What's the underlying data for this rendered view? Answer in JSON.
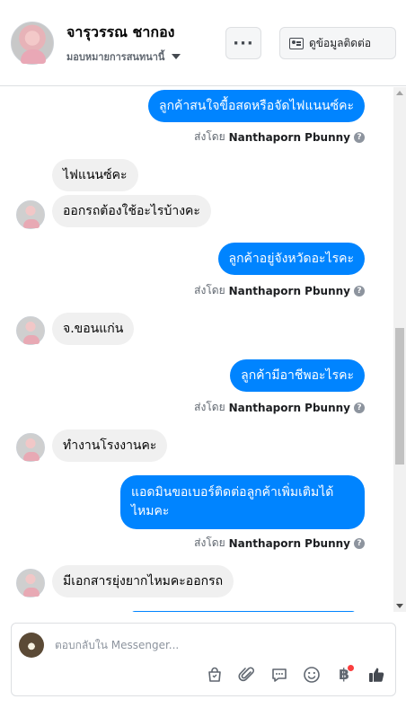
{
  "header": {
    "name": "จารุวรรณ ชากอง",
    "assign_label": "มอบหมายการสนทนานี้",
    "more_label": "···",
    "contact_button_label": "ดูข้อมูลติดต่อ"
  },
  "messages": [
    {
      "direction": "out",
      "text": "ลูกค้าสนใจขื้อสดหรือจัดไฟแนนซ์คะ"
    },
    {
      "direction": "meta",
      "sent_by_prefix": "ส่งโดย",
      "sender": "Nanthaporn Pbunny"
    },
    {
      "direction": "in",
      "text": "ไฟแนนซ์คะ"
    },
    {
      "direction": "in",
      "text": "ออกรถต้องใช้อะไรบ้างคะ"
    },
    {
      "direction": "out",
      "text": "ลูกค้าอยู่จังหวัดอะไรคะ"
    },
    {
      "direction": "meta",
      "sent_by_prefix": "ส่งโดย",
      "sender": "Nanthaporn Pbunny"
    },
    {
      "direction": "in",
      "text": "จ.ขอนแก่น"
    },
    {
      "direction": "out",
      "text": "ลูกค้ามีอาชีพอะไรคะ"
    },
    {
      "direction": "meta",
      "sent_by_prefix": "ส่งโดย",
      "sender": "Nanthaporn Pbunny"
    },
    {
      "direction": "in",
      "text": "ทำงานโรงงานคะ"
    },
    {
      "direction": "out",
      "text": "แอดมินขอเบอร์ติดต่อลูกค้าเพิ่มเติมได้ไหมคะ"
    },
    {
      "direction": "meta",
      "sent_by_prefix": "ส่งโดย",
      "sender": "Nanthaporn Pbunny"
    },
    {
      "direction": "in",
      "text": "มีเอกสารยุ่งยากไหมคะออกรถ"
    }
  ],
  "help_glyph": "?",
  "composer": {
    "placeholder": "ตอบกลับใน Messenger...",
    "tools": [
      "shopping-bag-icon",
      "paperclip-icon",
      "saved-replies-icon",
      "emoji-icon",
      "baht-payment-icon",
      "like-icon"
    ],
    "baht_symbol": "฿"
  },
  "colors": {
    "outgoing_bubble": "#0084ff",
    "incoming_bubble": "#f0f0f0",
    "badge": "#fa3e3e"
  }
}
